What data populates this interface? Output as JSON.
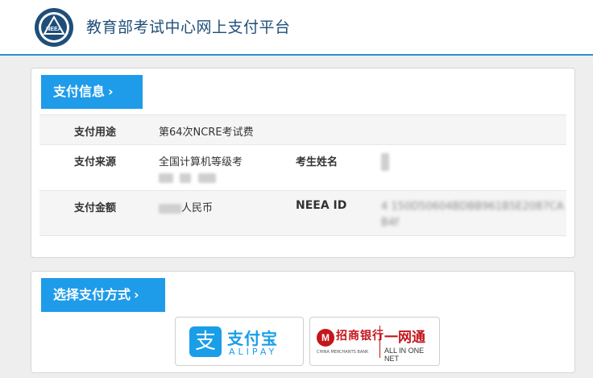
{
  "header": {
    "logo_text": "NEEA",
    "title": "教育部考试中心网上支付平台"
  },
  "payment_info": {
    "section_title": "支付信息",
    "rows": [
      {
        "label": "支付用途",
        "value": "第64次NCRE考试费"
      },
      {
        "label": "支付来源",
        "value": "全国计算机等级考",
        "label2": "考生姓名"
      },
      {
        "label": "支付金额",
        "value": "人民币",
        "label2": "NEEA ID",
        "value2": "4  150D50604BDBB961B5E2087CAB4f"
      }
    ]
  },
  "payment_method": {
    "section_title": "选择支付方式",
    "alipay": {
      "icon": "支",
      "name": "支付宝",
      "sub": "ALIPAY"
    },
    "cmb": {
      "logo": "M",
      "name": "招商银行",
      "en": "CHINA MERCHANTS BANK",
      "product": "一网通",
      "product_sub": "ALL IN ONE NET"
    }
  },
  "colors": {
    "accent": "#1e9be9",
    "header_line": "#2b8fd6",
    "cmb_red": "#c4161c"
  }
}
